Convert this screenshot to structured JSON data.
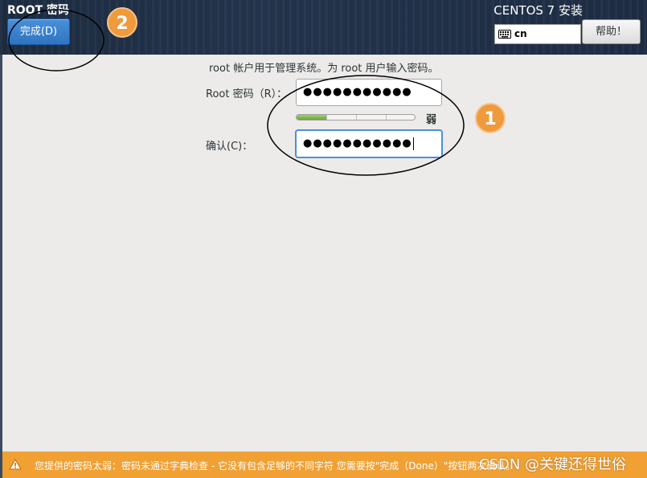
{
  "header": {
    "title": "ROOT 密码",
    "done_label": "完成(D)",
    "product": "CENTOS 7 安装",
    "keyboard": "cn",
    "help_label": "帮助！"
  },
  "form": {
    "intro": "root 帐户用于管理系统。为 root 用户输入密码。",
    "root_label": "Root 密码（R）：",
    "root_value": "●●●●●●●●●●●",
    "strength_label": "弱",
    "strength_level": 0.25,
    "confirm_label": "确认(C)：",
    "confirm_value": "●●●●●●●●●●●"
  },
  "annotations": {
    "badge_1": "1",
    "badge_2": "2"
  },
  "warning": {
    "text": "您提供的密码太弱：密码未通过字典检查 - 它没有包含足够的不同字符 您需要按\"完成（Done）\"按钮两次确认。"
  },
  "watermark": "CSDN @关键还得世俗",
  "colors": {
    "header_bg": "#1c2b3f",
    "accent_blue": "#2e74c0",
    "warning_orange": "#f1a033",
    "badge_orange": "#ef9a3c",
    "strength_green": "#6aa539"
  },
  "icons": {
    "keyboard": "keyboard-icon",
    "warning": "warning-triangle-icon"
  }
}
